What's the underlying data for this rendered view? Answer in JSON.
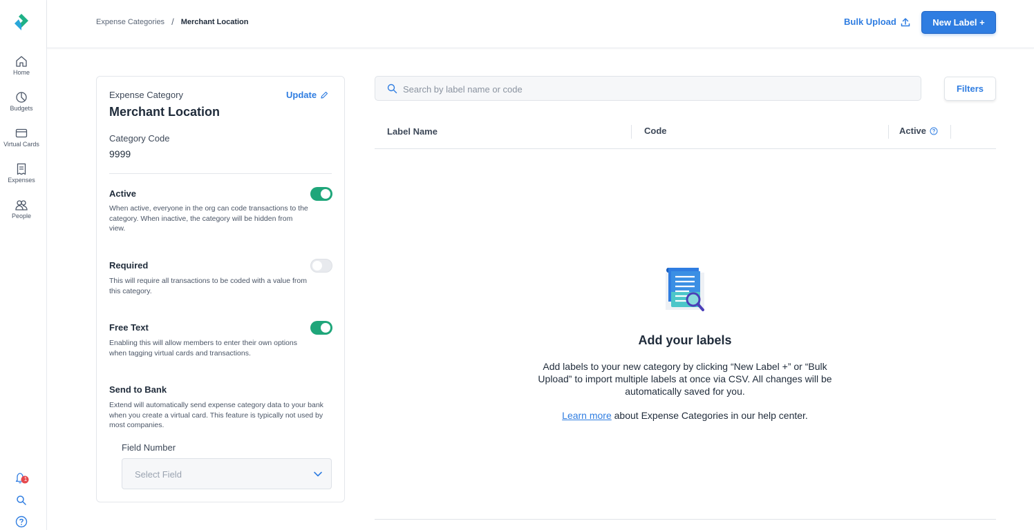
{
  "sidebar": {
    "items": [
      {
        "label": "Home",
        "icon": "home-icon"
      },
      {
        "label": "Budgets",
        "icon": "pie-chart-icon"
      },
      {
        "label": "Virtual Cards",
        "icon": "card-icon"
      },
      {
        "label": "Expenses",
        "icon": "receipt-icon"
      },
      {
        "label": "People",
        "icon": "people-icon"
      }
    ],
    "notification_count": "1"
  },
  "header": {
    "breadcrumb": {
      "parent": "Expense Categories",
      "separator": "/",
      "current": "Merchant Location"
    },
    "bulk_upload": "Bulk Upload",
    "new_label": "New Label +"
  },
  "category": {
    "eyebrow": "Expense Category",
    "title": "Merchant Location",
    "update": "Update",
    "code_label": "Category Code",
    "code_value": "9999",
    "settings": [
      {
        "title": "Active",
        "desc": "When active, everyone in the org can code transactions to the category. When inactive, the category will be hidden from view.",
        "on": true
      },
      {
        "title": "Required",
        "desc": "This will require all transactions to be coded with a value from this category.",
        "on": false
      },
      {
        "title": "Free Text",
        "desc": "Enabling this will allow members to enter their own options when tagging virtual cards and transactions.",
        "on": true
      },
      {
        "title": "Send to Bank",
        "desc": "Extend will automatically send expense category data to your bank when you create a virtual card. This feature is typically not used by most companies."
      }
    ],
    "field_number_label": "Field Number",
    "field_number_placeholder": "Select Field"
  },
  "labels": {
    "search_placeholder": "Search by label name or code",
    "filters": "Filters",
    "columns": [
      "Label Name",
      "Code",
      "Active"
    ],
    "empty": {
      "title": "Add your labels",
      "body": "Add labels to your new category by clicking “New Label +” or “Bulk Upload” to import multiple labels at once via CSV. All changes will be automatically saved for you.",
      "link": "Learn more",
      "help_suffix": " about Expense Categories in our help center."
    }
  },
  "colors": {
    "accent": "#2f7de1",
    "toggle_on": "#1fa67a",
    "brand_green": "#1fb187",
    "badge": "#e5484d"
  }
}
